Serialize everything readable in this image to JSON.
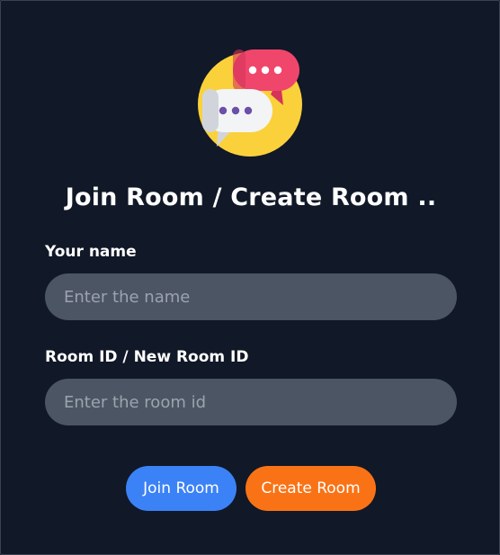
{
  "header": {
    "logo_icon": "chat-bubbles-icon",
    "title": "Join Room / Create Room .."
  },
  "form": {
    "name_label": "Your name",
    "name_placeholder": "Enter the name",
    "name_value": "",
    "room_label": "Room ID / New Room ID",
    "room_placeholder": "Enter the room id",
    "room_value": ""
  },
  "actions": {
    "join_label": "Join Room",
    "create_label": "Create Room"
  },
  "colors": {
    "background": "#111827",
    "input_bg": "#4b5563",
    "join_button": "#3b82f6",
    "create_button": "#f97316",
    "logo_circle": "#fbd13b",
    "logo_pink_bubble": "#f0466b",
    "logo_white_bubble": "#f3f4f6"
  }
}
